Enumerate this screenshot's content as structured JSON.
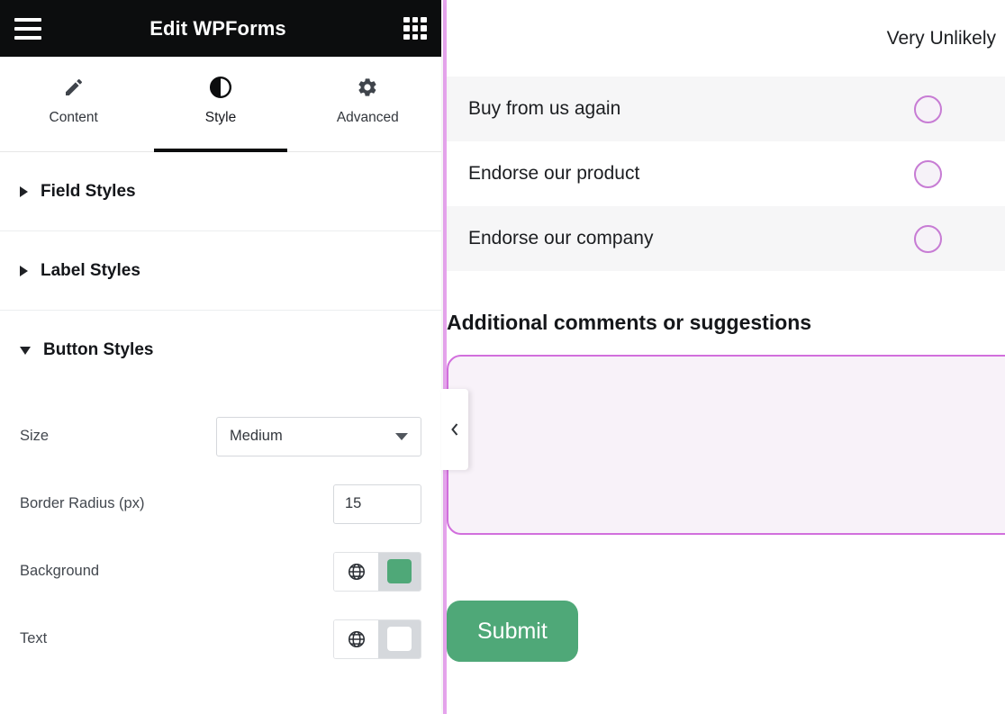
{
  "editor": {
    "header": {
      "title": "Edit WPForms",
      "menu_icon": "hamburger-icon",
      "apps_icon": "apps-grid-icon"
    },
    "tabs": [
      {
        "label": "Content",
        "icon": "pencil-icon",
        "active": false
      },
      {
        "label": "Style",
        "icon": "contrast-icon",
        "active": true
      },
      {
        "label": "Advanced",
        "icon": "gear-icon",
        "active": false
      }
    ],
    "sections": [
      {
        "title": "Field Styles",
        "expanded": false,
        "caret": "caret-right-icon"
      },
      {
        "title": "Label Styles",
        "expanded": false,
        "caret": "caret-right-icon"
      },
      {
        "title": "Button Styles",
        "expanded": true,
        "caret": "caret-down-icon"
      }
    ],
    "button_styles": {
      "size": {
        "label": "Size",
        "value": "Medium",
        "arrow_icon": "chevron-down-icon"
      },
      "border_radius": {
        "label": "Border Radius (px)",
        "value": "15"
      },
      "background": {
        "label": "Background",
        "globe_icon": "globe-icon",
        "swatch_color": "#4fa878"
      },
      "text": {
        "label": "Text",
        "globe_icon": "globe-icon",
        "swatch_color": "#ffffff"
      }
    },
    "collapse_handle": {
      "icon": "chevron-left-icon"
    }
  },
  "preview": {
    "likert": {
      "column_header": "Very Unlikely",
      "rows": [
        {
          "label": "Buy from us again"
        },
        {
          "label": "Endorse our product"
        },
        {
          "label": "Endorse our company"
        }
      ]
    },
    "comments": {
      "label": "Additional comments or suggestions",
      "value": "",
      "placeholder": ""
    },
    "submit": {
      "label": "Submit"
    },
    "accent_color": "#d26fdd",
    "rail_color": "#e9a6f0"
  }
}
